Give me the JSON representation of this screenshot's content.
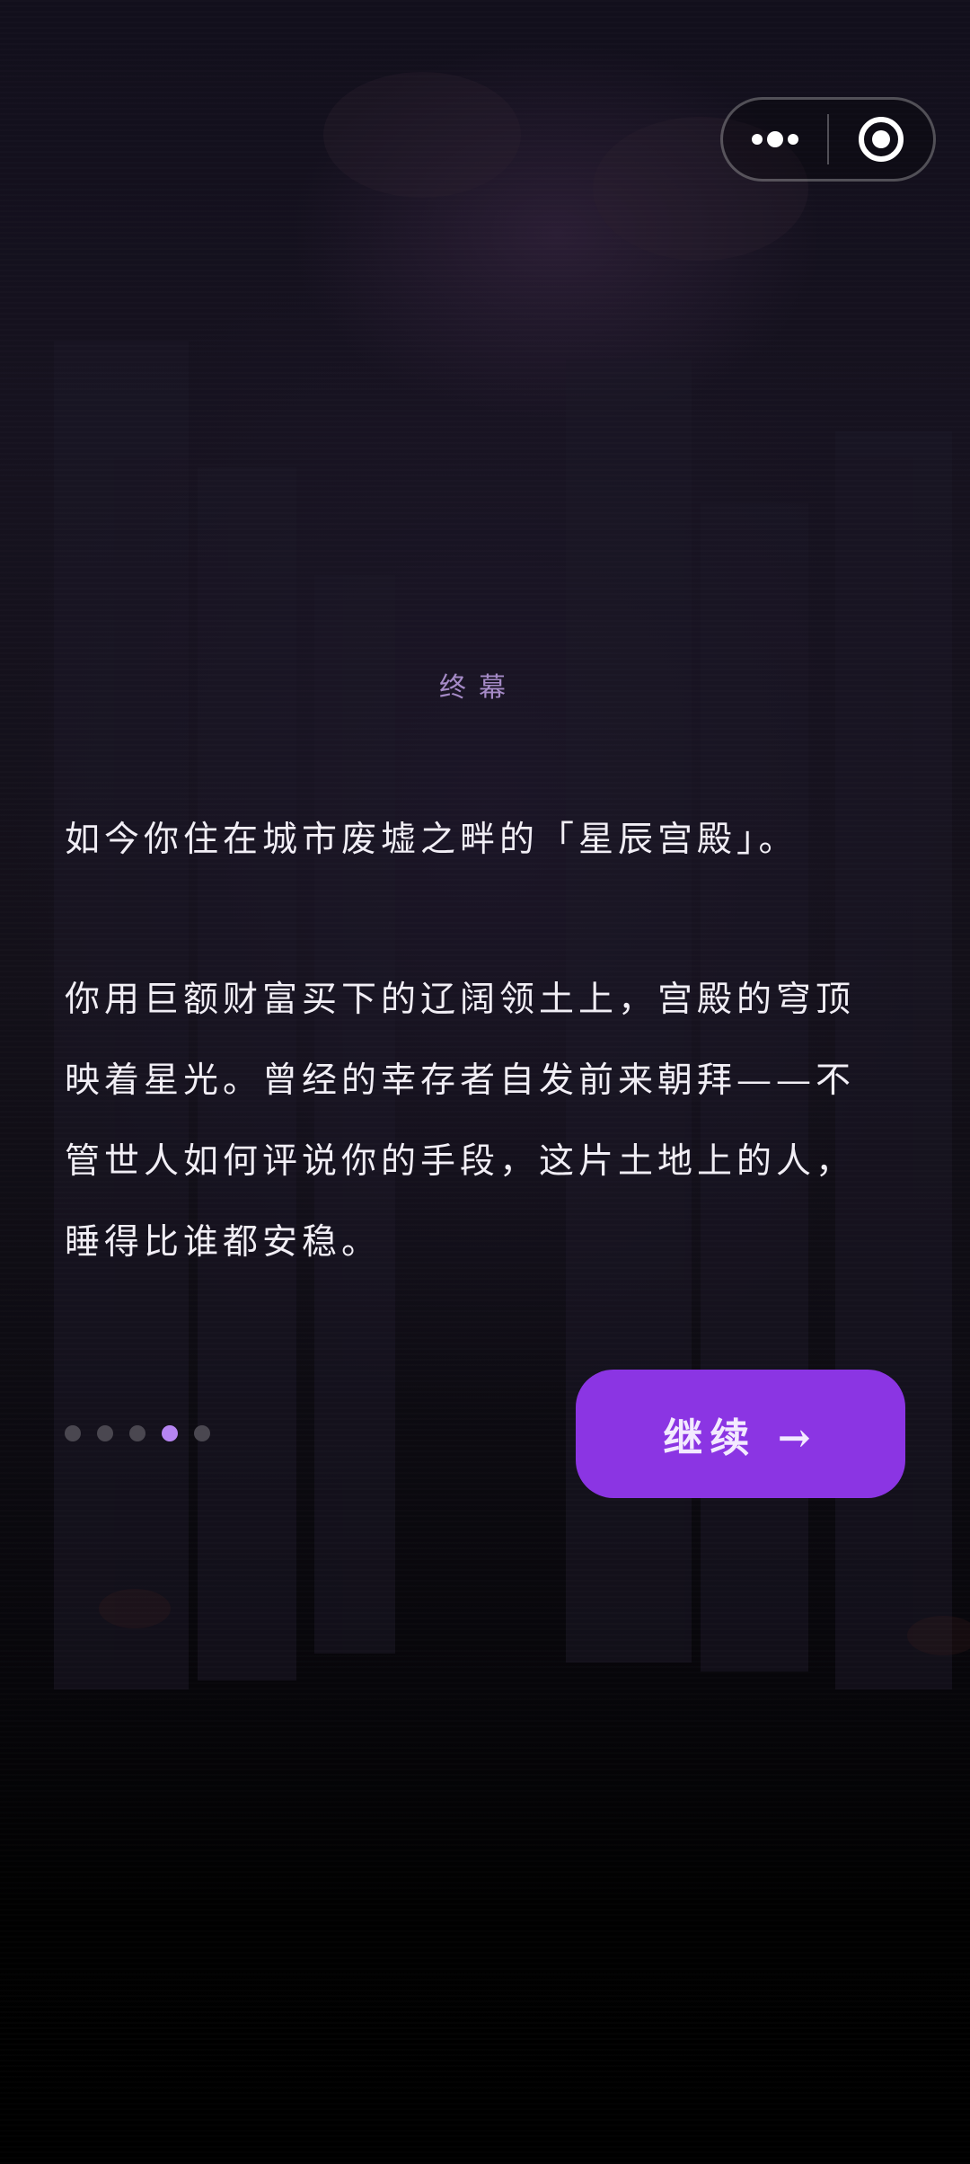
{
  "capsule": {
    "menu_icon": "more-dots-icon",
    "close_icon": "target-circle-icon"
  },
  "chapter": {
    "title": "终幕"
  },
  "story": {
    "paragraphs": [
      "如今你住在城市废墟之畔的「星辰宫殿」。",
      "你用巨额财富买下的辽阔领土上，宫殿的穹顶映着星光。曾经的幸存者自发前来朝拜——不管世人如何评说你的手段，这片土地上的人，睡得比谁都安稳。"
    ]
  },
  "pagination": {
    "total": 5,
    "current": 4
  },
  "actions": {
    "continue_label": "继续 →"
  },
  "colors": {
    "accent": "#8b35e3",
    "chapter_title": "#a58ac6",
    "active_dot": "#b685f2",
    "inactive_dot": "#4a4750",
    "text": "#f1eef5"
  }
}
